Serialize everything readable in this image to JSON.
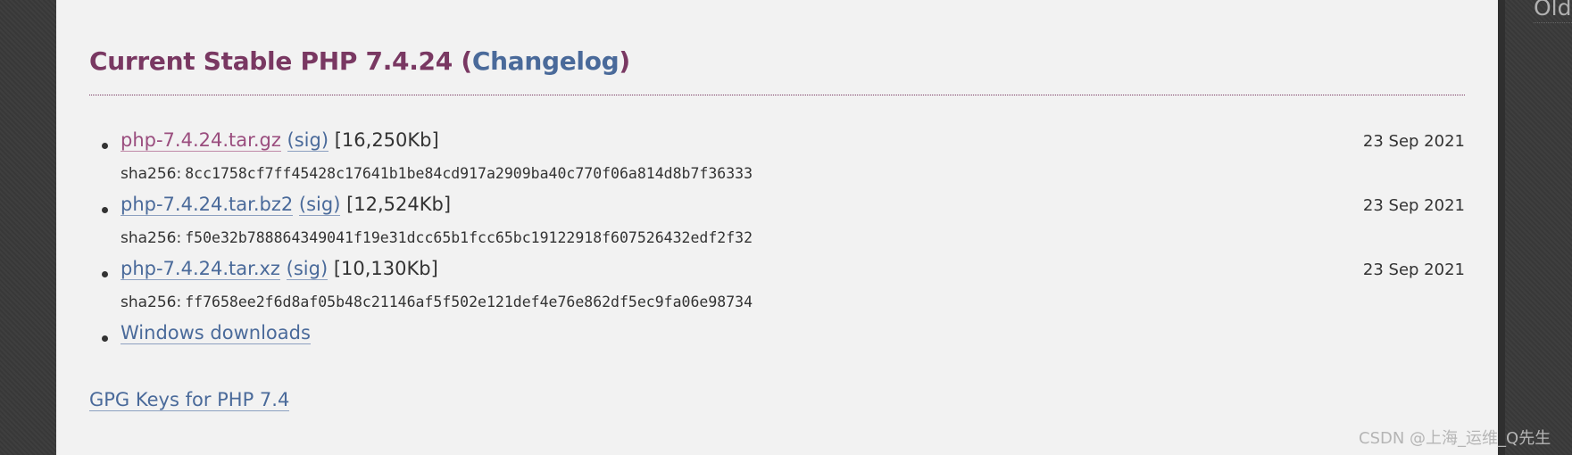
{
  "sidebar_fragment": "Old",
  "heading": {
    "text": "Current Stable PHP 7.4.24 (",
    "changelog_label": "Changelog",
    "close": ")"
  },
  "releases": [
    {
      "file_label": "php-7.4.24.tar.gz",
      "visited": true,
      "sig_label": "(sig)",
      "size": "[16,250Kb]",
      "date": "23 Sep 2021",
      "sha_label": "sha256:",
      "sha": "8cc1758cf7ff45428c17641b1be84cd917a2909ba40c770f06a814d8b7f36333"
    },
    {
      "file_label": "php-7.4.24.tar.bz2",
      "visited": false,
      "sig_label": "(sig)",
      "size": "[12,524Kb]",
      "date": "23 Sep 2021",
      "sha_label": "sha256:",
      "sha": "f50e32b788864349041f19e31dcc65b1fcc65bc19122918f607526432edf2f32"
    },
    {
      "file_label": "php-7.4.24.tar.xz",
      "visited": false,
      "sig_label": "(sig)",
      "size": "[10,130Kb]",
      "date": "23 Sep 2021",
      "sha_label": "sha256:",
      "sha": "ff7658ee2f6d8af05b48c21146af5f502e121def4e76e862df5ec9fa06e98734"
    }
  ],
  "windows_downloads_label": "Windows downloads",
  "gpg_keys_label": "GPG Keys for PHP 7.4",
  "watermark": "CSDN @上海_运维_Q先生",
  "colors": {
    "heading": "#793862",
    "link": "#4a6a9a",
    "visited_link": "#9a4d7e",
    "panel_background": "#f2f2f2",
    "page_background": "#3a3a3a"
  }
}
